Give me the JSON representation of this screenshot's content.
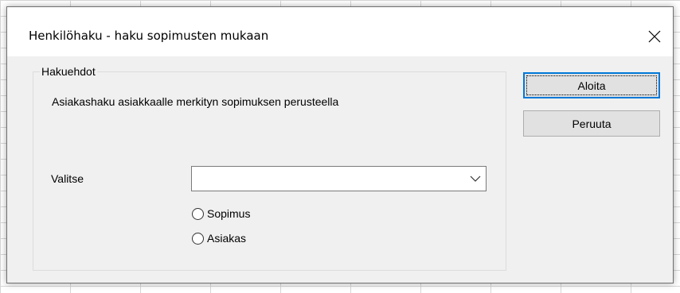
{
  "dialog": {
    "title": "Henkilöhaku - haku sopimusten mukaan",
    "close_icon": "close-icon"
  },
  "group": {
    "legend": "Hakuehdot",
    "description": "Asiakashaku asiakkaalle merkityn sopimuksen perusteella",
    "select_label": "Valitse",
    "select_value": "",
    "dropdown_icon": "chevron-down-icon",
    "radios": [
      {
        "label": "Sopimus",
        "checked": false
      },
      {
        "label": "Asiakas",
        "checked": false
      }
    ]
  },
  "buttons": {
    "start_label": "Aloita",
    "cancel_label": "Peruuta"
  },
  "colors": {
    "focus_border": "#0078d7",
    "dialog_bg": "#f0f0f0",
    "button_bg": "#e1e1e1"
  }
}
